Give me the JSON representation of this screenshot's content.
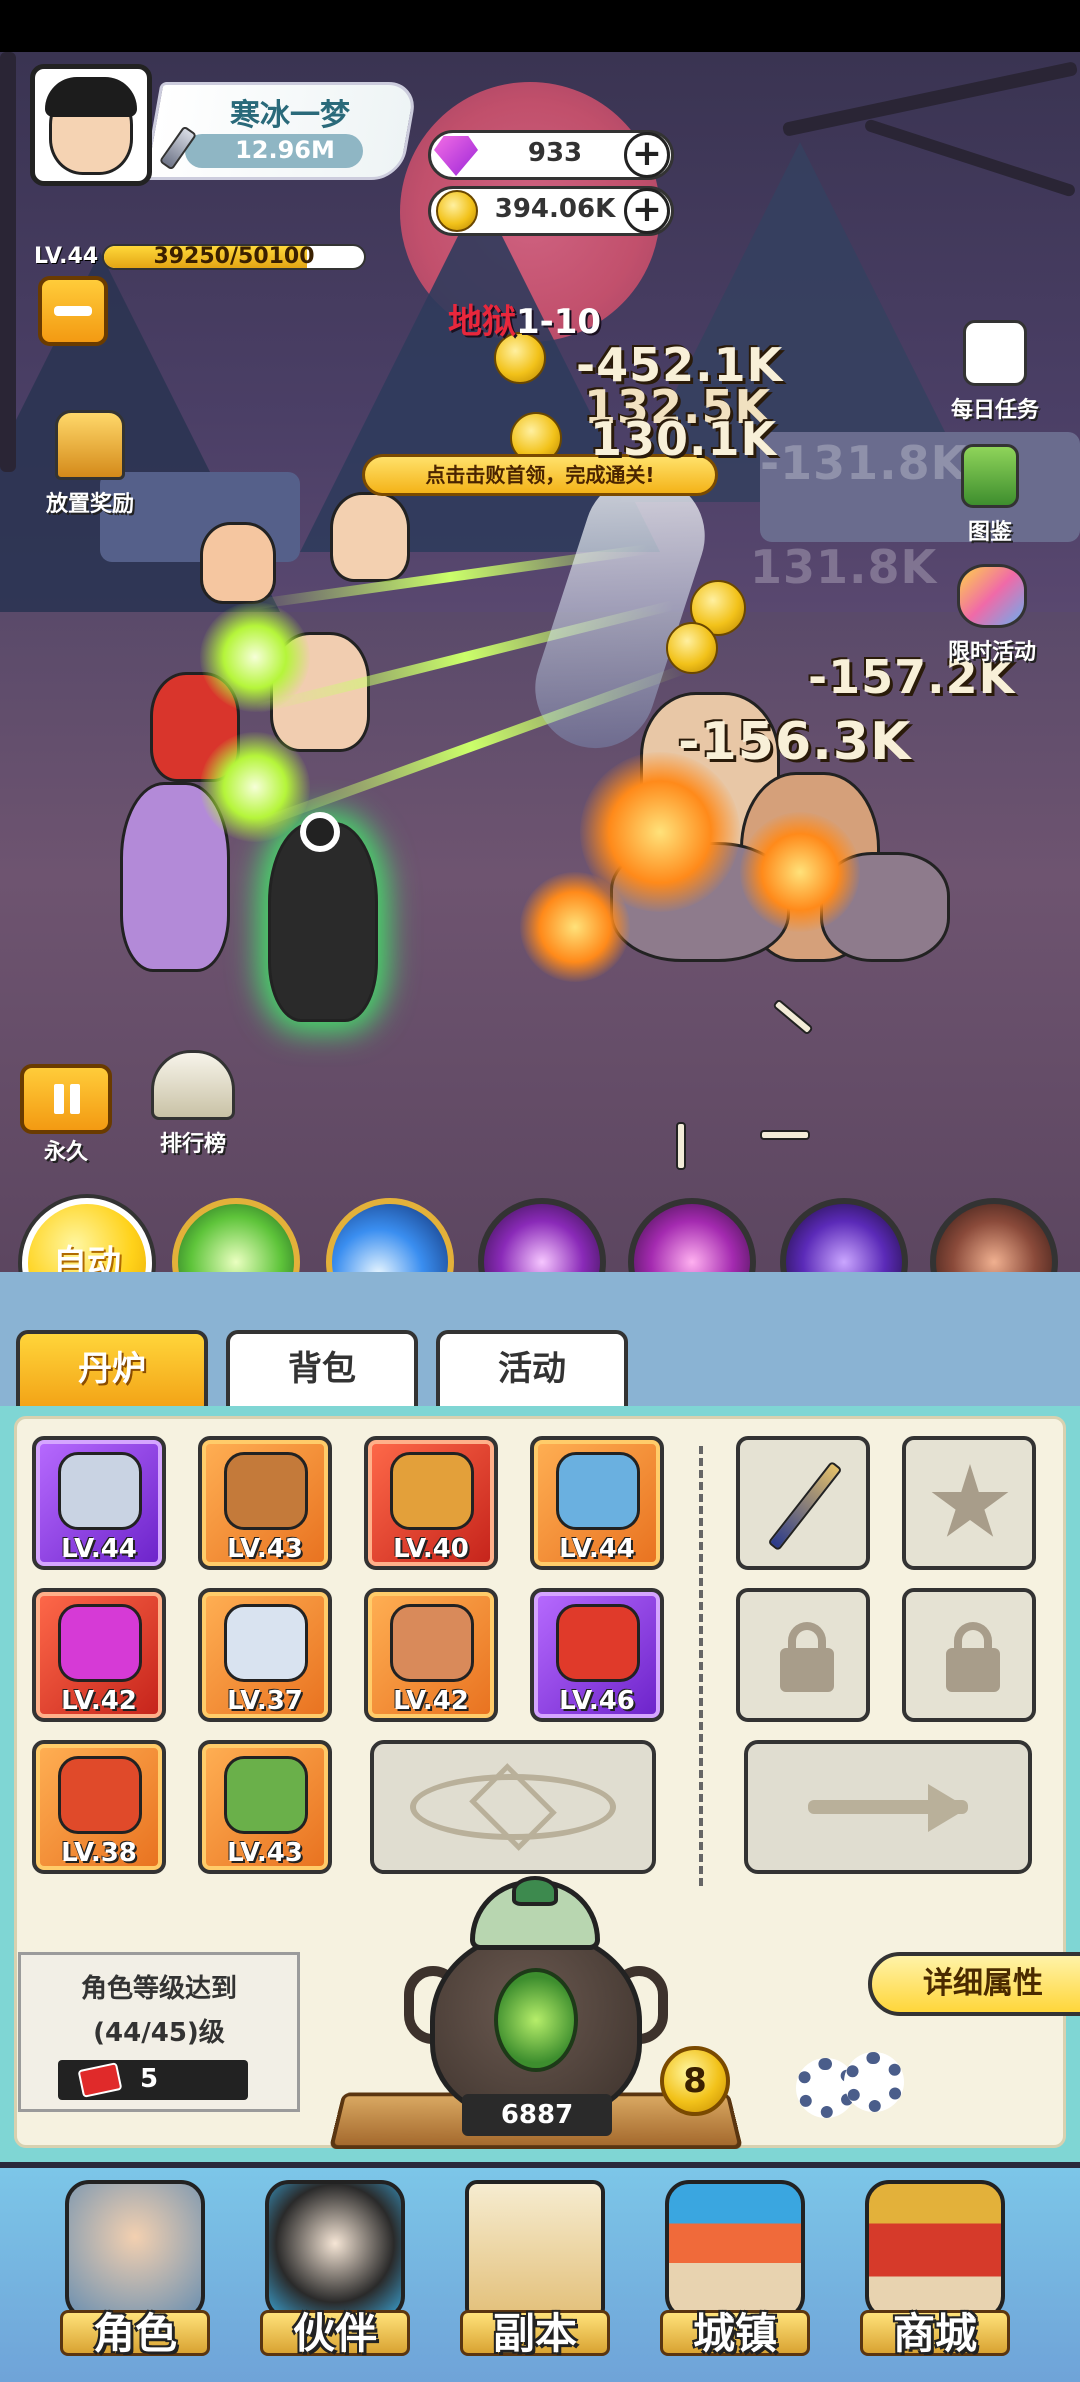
{
  "player": {
    "name": "寒冰一梦",
    "power": "12.96M",
    "level": "LV.44",
    "xp": "39250/50100",
    "xp_fraction": 0.78
  },
  "currency": {
    "gems": "933",
    "coins": "394.06K"
  },
  "battle": {
    "stage_prefix": "地狱",
    "stage_number": "1-10",
    "hint": "点击击败首领，完成通关!",
    "damage": [
      "-452.1K",
      "132.5K",
      "130.1K",
      "-131.8K",
      "131.8K",
      "-157.2K",
      "-156.3K"
    ]
  },
  "side_buttons": {
    "idle_reward": "放置奖励",
    "daily_tasks": "每日任务",
    "codex": "图鉴",
    "limited_event": "限时活动",
    "permanent": "永久",
    "leaderboard": "排行榜"
  },
  "skills": {
    "auto_label": "自动",
    "icons": [
      "green-orb-skill-icon",
      "blue-comet-skill-icon",
      "purple-lightning-skill-icon",
      "purple-vortex-skill-icon",
      "dark-spiral-skill-icon",
      "beast-skill-icon"
    ]
  },
  "tabs": [
    "丹炉",
    "背包",
    "活动"
  ],
  "equipment": [
    {
      "level": "LV.44",
      "rarity": "purple",
      "icon": "sword-icon"
    },
    {
      "level": "LV.43",
      "rarity": "orange",
      "icon": "helmet-icon"
    },
    {
      "level": "LV.40",
      "rarity": "red",
      "icon": "armor-icon"
    },
    {
      "level": "LV.44",
      "rarity": "orange",
      "icon": "orb-icon"
    },
    {
      "level": "LV.42",
      "rarity": "red",
      "icon": "flame-icon"
    },
    {
      "level": "LV.37",
      "rarity": "orange",
      "icon": "shield-icon"
    },
    {
      "level": "LV.42",
      "rarity": "orange",
      "icon": "ring-icon"
    },
    {
      "level": "LV.46",
      "rarity": "purple",
      "icon": "gem-icon"
    },
    {
      "level": "LV.38",
      "rarity": "orange",
      "icon": "gauntlet-icon"
    },
    {
      "level": "LV.43",
      "rarity": "orange",
      "icon": "boots-icon"
    }
  ],
  "furnace": {
    "count": "6887",
    "level": "8"
  },
  "info": {
    "line1": "角色等级达到",
    "line2": "(44/45)级",
    "tickets": "5"
  },
  "detail_button": "详细属性",
  "nav": [
    "角色",
    "伙伴",
    "副本",
    "城镇",
    "商城"
  ],
  "colors": {
    "accent_gold": "#f3a417",
    "panel_teal": "#7fd6d4",
    "nav_blue": "#6fa3d8"
  }
}
